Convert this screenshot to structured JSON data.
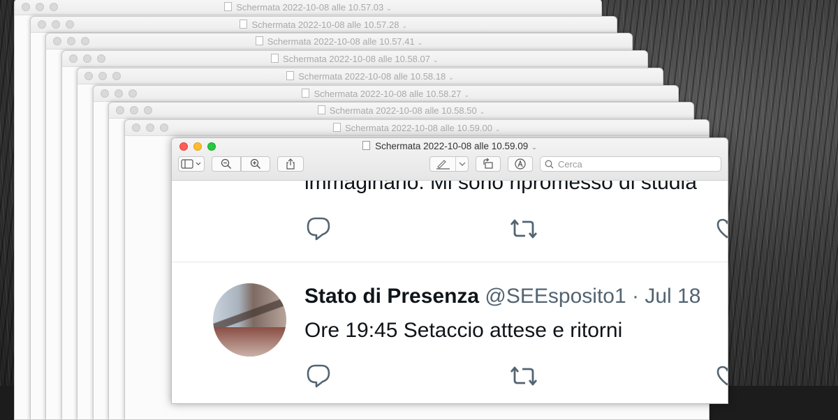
{
  "windows": [
    {
      "title": "Schermata 2022-10-08 alle 10.57.03"
    },
    {
      "title": "Schermata 2022-10-08 alle 10.57.28"
    },
    {
      "title": "Schermata 2022-10-08 alle 10.57.41"
    },
    {
      "title": "Schermata 2022-10-08 alle 10.58.07"
    },
    {
      "title": "Schermata 2022-10-08 alle 10.58.18"
    },
    {
      "title": "Schermata 2022-10-08 alle 10.58.27"
    },
    {
      "title": "Schermata 2022-10-08 alle 10.58.50"
    },
    {
      "title": "Schermata 2022-10-08 alle 10.59.00"
    }
  ],
  "front": {
    "title": "Schermata 2022-10-08 alle 10.59.09",
    "search_placeholder": "Cerca",
    "toolbar_icons": [
      "sidebar-icon",
      "zoom-out-icon",
      "zoom-in-icon",
      "share-icon",
      "markup-pen-icon",
      "rotate-icon",
      "annotate-icon",
      "search-icon"
    ]
  },
  "tweets": {
    "prev_text": "immaginario. Mi sono ripromesso di studia",
    "name": "Stato di Presenza",
    "handle": "@SEEsposito1",
    "separator": "·",
    "date": "Jul 18",
    "text": "Ore 19:45 Setaccio attese e ritorni"
  },
  "colors": {
    "red": "#ff5f57",
    "yellow": "#febc2e",
    "green": "#28c840",
    "twitter_gray": "#536471"
  }
}
